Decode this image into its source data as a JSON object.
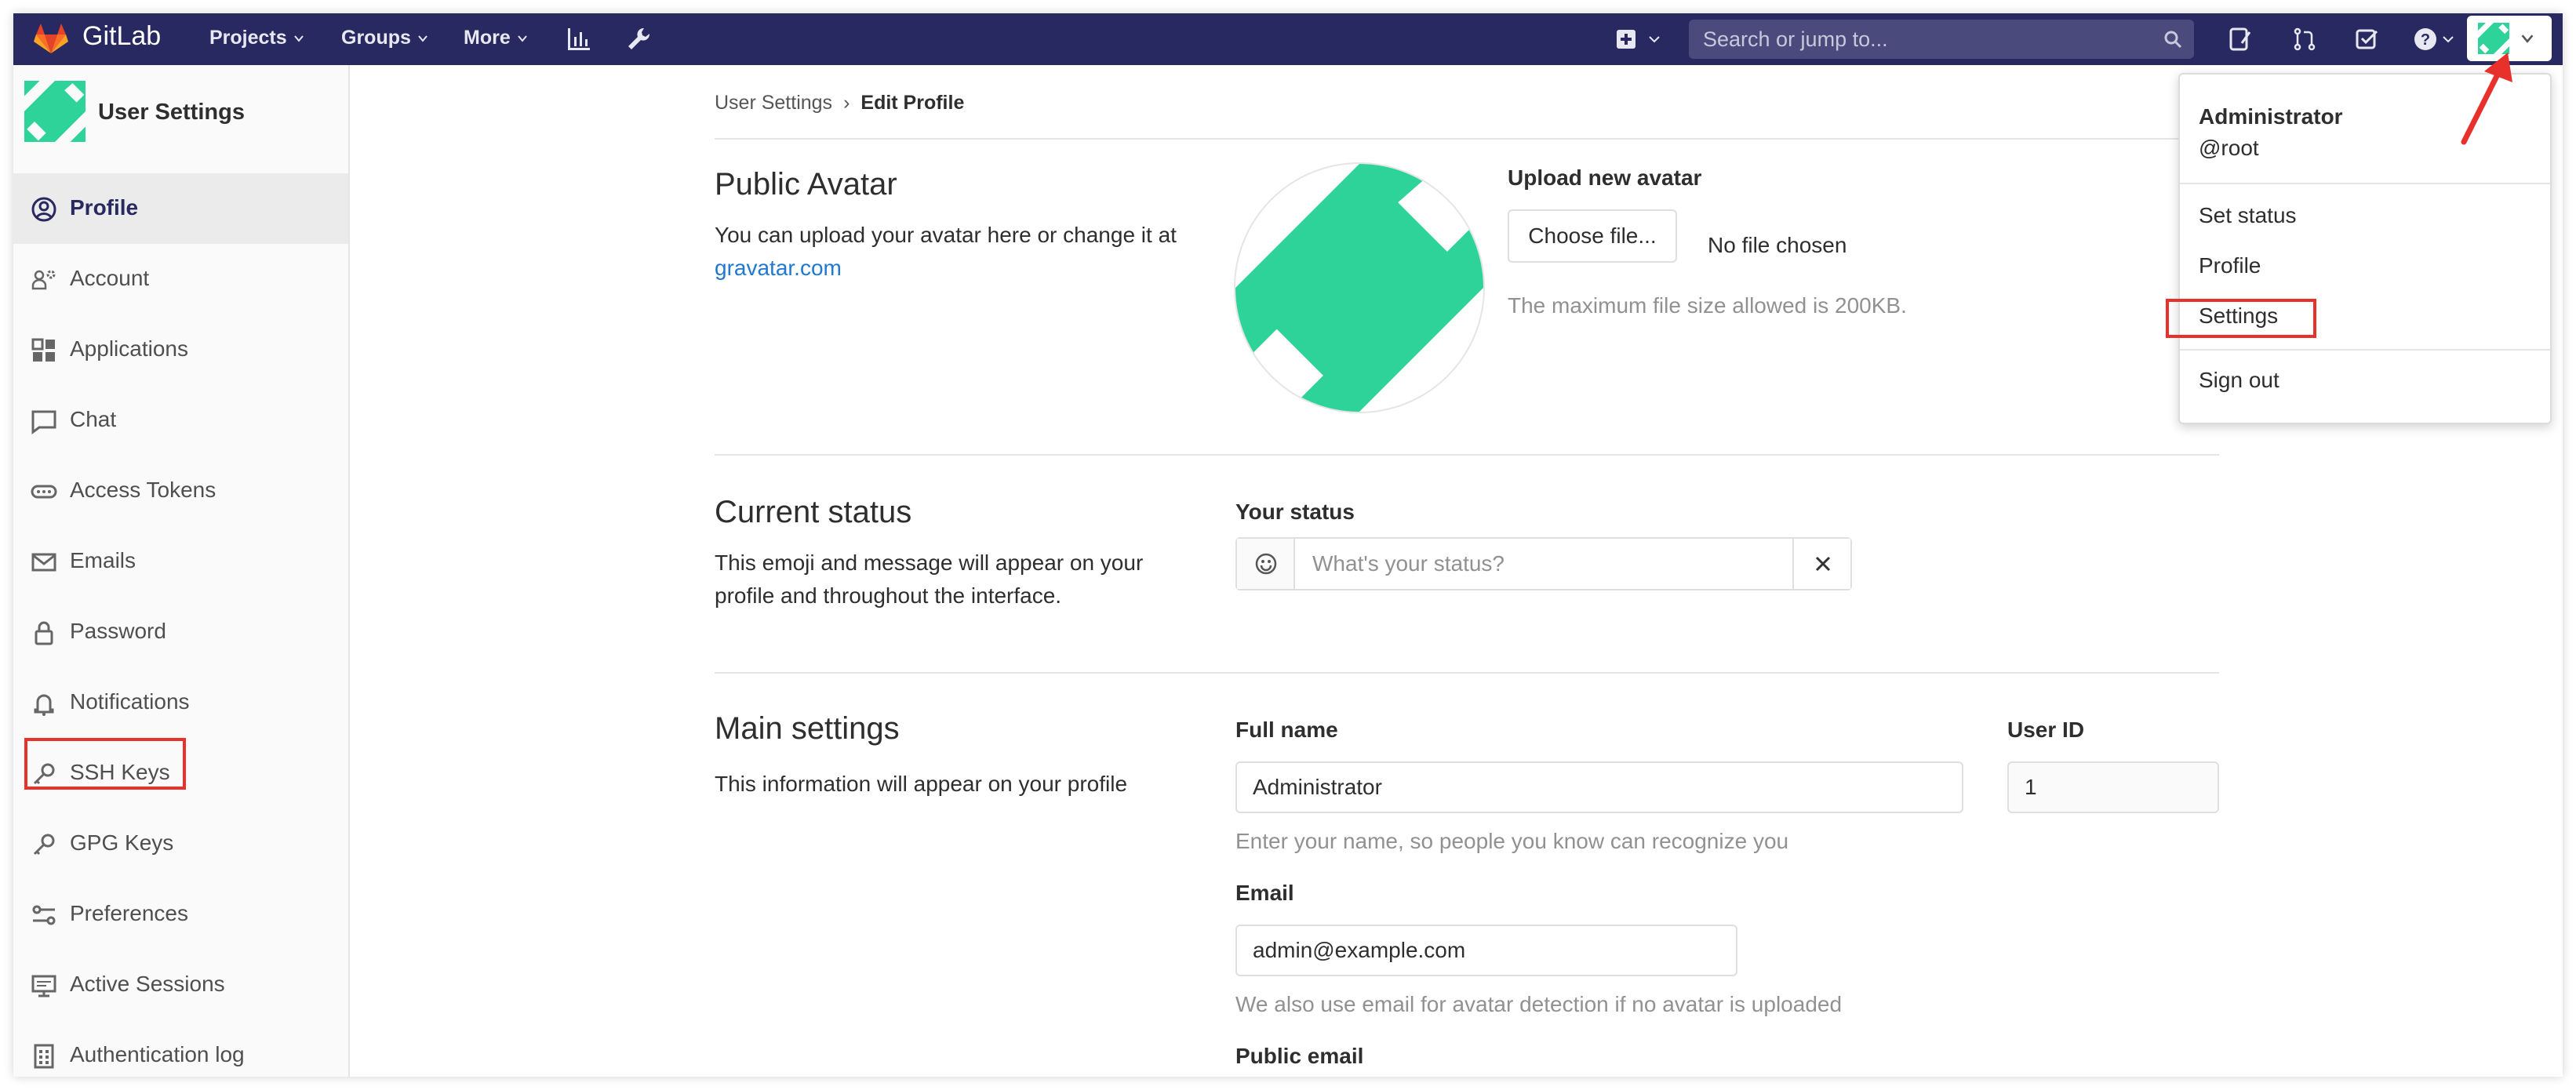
{
  "navbar": {
    "brand": "GitLab",
    "menus": [
      "Projects",
      "Groups",
      "More"
    ],
    "search_placeholder": "Search or jump to..."
  },
  "sidebar": {
    "title": "User Settings",
    "items": [
      {
        "label": "Profile",
        "icon": "profile-icon",
        "active": true
      },
      {
        "label": "Account",
        "icon": "account-icon"
      },
      {
        "label": "Applications",
        "icon": "applications-icon"
      },
      {
        "label": "Chat",
        "icon": "chat-icon"
      },
      {
        "label": "Access Tokens",
        "icon": "access-tokens-icon"
      },
      {
        "label": "Emails",
        "icon": "emails-icon"
      },
      {
        "label": "Password",
        "icon": "lock-icon"
      },
      {
        "label": "Notifications",
        "icon": "bell-icon"
      },
      {
        "label": "SSH Keys",
        "icon": "key-icon"
      },
      {
        "label": "GPG Keys",
        "icon": "key-icon"
      },
      {
        "label": "Preferences",
        "icon": "preferences-icon"
      },
      {
        "label": "Active Sessions",
        "icon": "monitor-icon"
      },
      {
        "label": "Authentication log",
        "icon": "log-icon"
      }
    ]
  },
  "breadcrumb": {
    "root": "User Settings",
    "separator": "›",
    "current": "Edit Profile"
  },
  "avatar_section": {
    "title": "Public Avatar",
    "desc_text": "You can upload your avatar here or change it at",
    "desc_link": "gravatar.com",
    "upload_label": "Upload new avatar",
    "choose_button": "Choose file...",
    "no_file": "No file chosen",
    "help": "The maximum file size allowed is 200KB."
  },
  "status_section": {
    "title": "Current status",
    "desc": "This emoji and message will appear on your profile and throughout the interface.",
    "label": "Your status",
    "placeholder": "What's your status?"
  },
  "main_section": {
    "title": "Main settings",
    "desc": "This information will appear on your profile",
    "fullname_label": "Full name",
    "fullname_value": "Administrator",
    "fullname_help": "Enter your name, so people you know can recognize you",
    "userid_label": "User ID",
    "userid_value": "1",
    "email_label": "Email",
    "email_value": "admin@example.com",
    "email_help": "We also use email for avatar detection if no avatar is uploaded",
    "public_email_label": "Public email"
  },
  "user_dropdown": {
    "name": "Administrator",
    "username": "@root",
    "items": [
      "Set status",
      "Profile",
      "Settings",
      "Sign out"
    ]
  },
  "colors": {
    "navbar": "#292961",
    "avatar_green": "#2ed399",
    "highlight": "#e8312a",
    "link": "#1f78d1"
  }
}
